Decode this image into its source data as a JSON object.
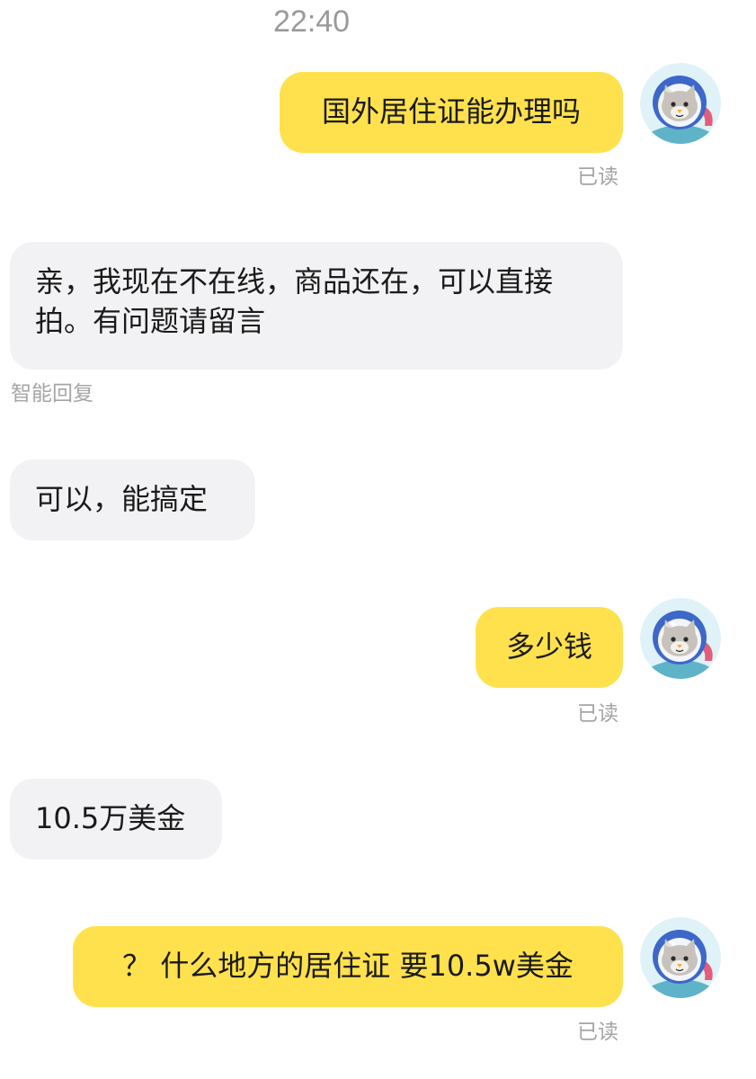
{
  "chat": {
    "timestamp": "22:40",
    "messages": [
      {
        "direction": "outgoing",
        "text": "国外居住证能办理吗",
        "status": "已读"
      },
      {
        "direction": "incoming",
        "text": "亲，我现在不在线，商品还在，可以直接拍。有问题请留言",
        "note": "智能回复"
      },
      {
        "direction": "incoming",
        "text": "可以，能搞定"
      },
      {
        "direction": "outgoing",
        "text": "多少钱",
        "status": "已读"
      },
      {
        "direction": "incoming",
        "text": "10.5万美金"
      },
      {
        "direction": "outgoing",
        "text": "？ 什么地方的居住证 要10.5w美金",
        "status": "已读"
      }
    ]
  },
  "avatar": {
    "icon": "cat-astronaut-avatar-icon",
    "colors": {
      "background": "#dff2f8",
      "helmet": "#3d67c9",
      "face": "#c7c2bb",
      "accent": "#e35d7a",
      "nose": "#f3b23a"
    }
  },
  "colors": {
    "outgoing_bubble": "#ffe14d",
    "incoming_bubble": "#f2f2f4",
    "meta_text": "#a5a5a5",
    "timestamp_text": "#9a9a9a"
  }
}
